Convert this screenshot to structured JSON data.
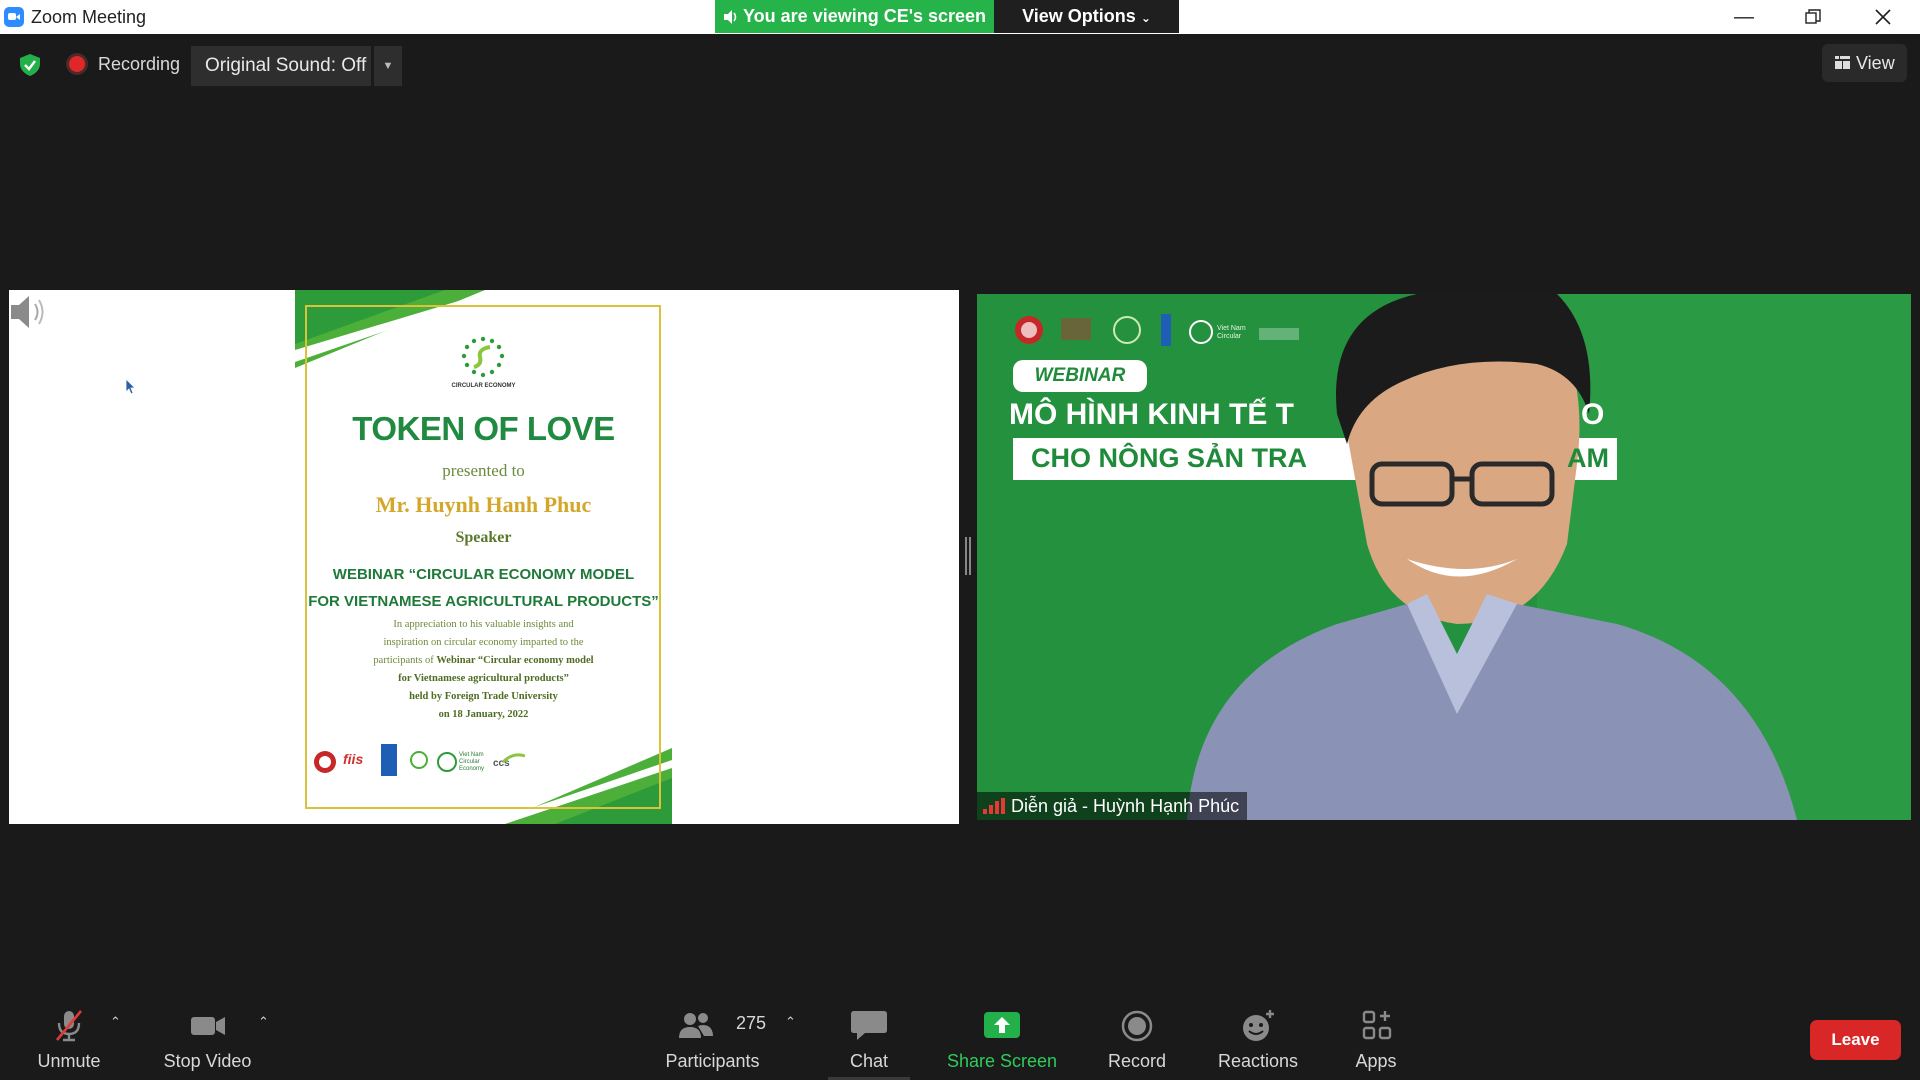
{
  "window": {
    "title": "Zoom Meeting"
  },
  "banner": {
    "viewing_text": "You are viewing CE's screen",
    "view_options": "View Options"
  },
  "top_bar": {
    "recording_label": "Recording",
    "original_sound": "Original Sound: Off",
    "view_label": "View"
  },
  "certificate": {
    "logo_caption": "CIRCULAR ECONOMY",
    "title": "TOKEN OF LOVE",
    "presented_to": "presented to",
    "recipient": "Mr. Huynh Hanh Phuc",
    "role": "Speaker",
    "webinar_line1": "WEBINAR “CIRCULAR ECONOMY MODEL",
    "webinar_line2": "FOR VIETNAMESE AGRICULTURAL PRODUCTS”",
    "body_line1": "In appreciation to his valuable insights and",
    "body_line2": "inspiration on circular economy imparted to the",
    "body_line3_pre": "participants of ",
    "body_line3_bold": "Webinar “Circular economy model",
    "body_line4": "for Vietnamese agricultural products”",
    "body_line5": "held by Foreign Trade University",
    "body_line6": "on 18 January, 2022"
  },
  "video": {
    "webinar_badge": "WEBINAR",
    "headline_1": "MÔ HÌNH KINH TẾ T",
    "headline_1_end": "O",
    "headline_2": "CHO NÔNG SẢN TRA",
    "headline_2_end": "AM",
    "participant_name": "Diễn giả - Huỳnh Hạnh Phúc"
  },
  "toolbar": {
    "unmute": "Unmute",
    "stop_video": "Stop Video",
    "participants": "Participants",
    "participants_count": "275",
    "chat": "Chat",
    "share_screen": "Share Screen",
    "record": "Record",
    "reactions": "Reactions",
    "apps": "Apps",
    "leave": "Leave"
  },
  "colors": {
    "share_green": "#26b34a",
    "leave_red": "#d92626",
    "brand_blue": "#2d8cff"
  }
}
